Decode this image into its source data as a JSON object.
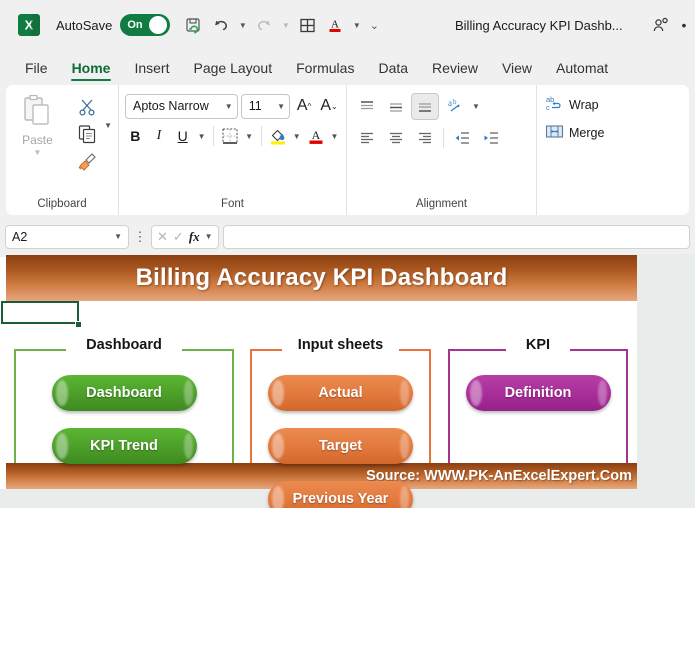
{
  "titlebar": {
    "app_icon": "excel-logo",
    "autosave_label": "AutoSave",
    "autosave_state": "On",
    "document_title": "Billing Accuracy KPI Dashb...",
    "qat": [
      {
        "name": "save-refresh-icon",
        "glyph": "⭳"
      },
      {
        "name": "undo-icon",
        "glyph": "↶"
      },
      {
        "name": "redo-icon",
        "glyph": "↷"
      },
      {
        "name": "table-icon",
        "glyph": "⊞"
      },
      {
        "name": "font-color-icon",
        "glyph": "A"
      },
      {
        "name": "customize-quick-access-toolbar-icon",
        "glyph": "⌄"
      }
    ],
    "share_icon": "person-share-icon",
    "more_icon": "more-options-icon"
  },
  "ribbon_tabs": [
    {
      "label": "File",
      "active": false
    },
    {
      "label": "Home",
      "active": true
    },
    {
      "label": "Insert",
      "active": false
    },
    {
      "label": "Page Layout",
      "active": false
    },
    {
      "label": "Formulas",
      "active": false
    },
    {
      "label": "Data",
      "active": false
    },
    {
      "label": "Review",
      "active": false
    },
    {
      "label": "View",
      "active": false
    },
    {
      "label": "Automat",
      "active": false
    }
  ],
  "ribbon": {
    "clipboard": {
      "title": "Clipboard",
      "paste_label": "Paste",
      "cut_icon": "scissors-icon",
      "copy_icon": "copy-icon",
      "format_painter_icon": "format-painter-icon"
    },
    "font": {
      "title": "Font",
      "font_name": "Aptos Narrow",
      "font_size": "11",
      "grow_font_icon": "increase-font-size-icon",
      "shrink_font_icon": "decrease-font-size-icon",
      "bold_label": "B",
      "italic_label": "I",
      "underline_label": "U",
      "borders_icon": "borders-icon",
      "fill_color_icon": "fill-color-icon",
      "font_color_icon": "font-color-icon",
      "fill_color": "#FFF200",
      "font_color": "#E00000"
    },
    "alignment": {
      "title": "Alignment",
      "top_align_icon": "align-top-icon",
      "middle_align_icon": "align-middle-icon",
      "bottom_align_icon": "align-bottom-icon",
      "orientation_icon": "text-orientation-icon",
      "align_left_icon": "align-left-icon",
      "align_center_icon": "align-center-icon",
      "align_right_icon": "align-right-icon",
      "decrease_indent_icon": "decrease-indent-icon",
      "increase_indent_icon": "increase-indent-icon",
      "wrap_label": "Wrap",
      "wrap_icon": "wrap-text-icon",
      "merge_label": "Merge",
      "merge_icon": "merge-cells-icon"
    }
  },
  "formula_bar": {
    "name_box_value": "A2",
    "cancel_icon": "cancel-icon",
    "enter_icon": "enter-icon",
    "function_icon": "insert-function-icon",
    "formula_value": "",
    "formula_placeholder": ""
  },
  "dashboard": {
    "banner_title": "Billing Accuracy KPI Dashboard",
    "footer_source": "Source: WWW.PK-AnExcelExpert.Com",
    "banner_gradient_top": "#8a3f12",
    "banner_gradient_bottom": "#e7a780",
    "panels": [
      {
        "label": "Dashboard",
        "border_color": "#70b14b",
        "buttons": [
          {
            "label": "Dashboard",
            "color": "#4a9e2a"
          },
          {
            "label": "KPI Trend",
            "color": "#4a9e2a"
          }
        ]
      },
      {
        "label": "Input sheets",
        "border_color": "#e8743b",
        "buttons": [
          {
            "label": "Actual",
            "color": "#e2783c"
          },
          {
            "label": "Target",
            "color": "#e2783c"
          },
          {
            "label": "Previous Year",
            "color": "#e2783c"
          }
        ]
      },
      {
        "label": "KPI",
        "border_color": "#a4358f",
        "buttons": [
          {
            "label": "Definition",
            "color": "#ab2d9b"
          }
        ]
      }
    ]
  }
}
